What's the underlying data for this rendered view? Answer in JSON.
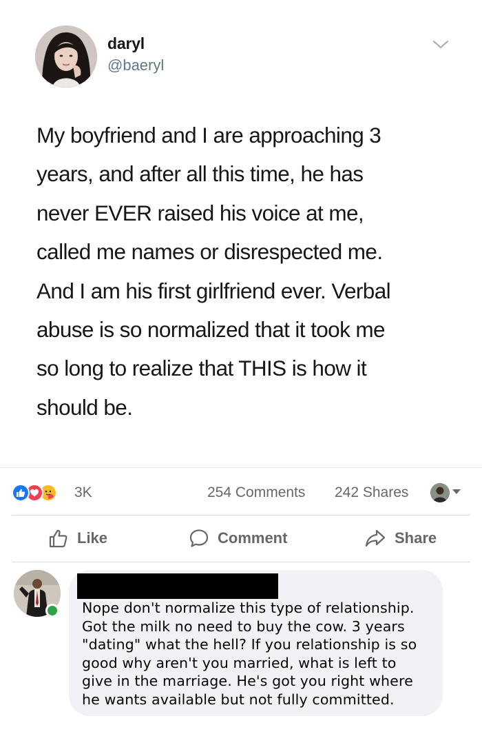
{
  "tweet": {
    "display_name": "daryl",
    "handle": "@baeryl",
    "text": "My boyfriend and I are approaching 3\nyears, and after all this time, he has\nnever EVER raised his voice at me,\ncalled me names or disrespected me.\nAnd I am his first girlfriend ever. Verbal\nabuse is so normalized that it took me\nso long to realize that THIS is how it\nshould be.",
    "menu_icon": "chevron-down-icon"
  },
  "stats": {
    "reactions": [
      "like",
      "love",
      "care"
    ],
    "reaction_count": "3K",
    "comments": "254 Comments",
    "shares": "242 Shares"
  },
  "actions": {
    "like_label": "Like",
    "comment_label": "Comment",
    "share_label": "Share"
  },
  "comment": {
    "text": "Nope don't normalize this type of relationship.\nGot the milk no need to buy the cow. 3 years\n\"dating\" what the hell? If you relationship is so\ngood why aren't you married, what is left to\ngive in the marriage. He's got you right where\nhe wants available but not fully committed."
  },
  "colors": {
    "facebook_blue": "#1877f2",
    "love_red": "#f33e58",
    "care_yellow": "#f7b928",
    "online_green": "#31a24c",
    "muted_text": "#65676b",
    "handle_gray": "#657786"
  }
}
